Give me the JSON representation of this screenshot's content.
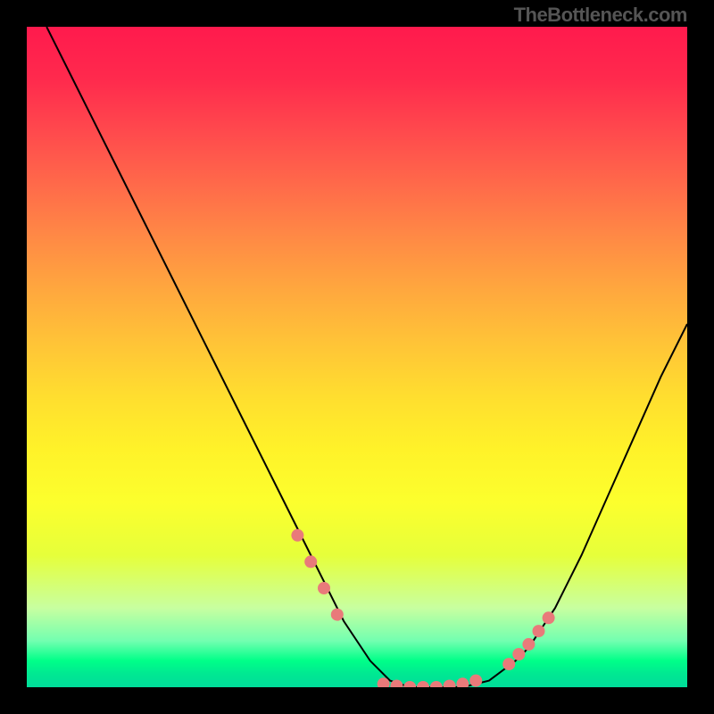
{
  "watermark": "TheBottleneck.com",
  "colors": {
    "marker": "#e97a7a",
    "curve": "#000000"
  },
  "chart_data": {
    "type": "line",
    "title": "",
    "xlabel": "",
    "ylabel": "",
    "xlim": [
      0,
      100
    ],
    "ylim": [
      0,
      100
    ],
    "grid": false,
    "series": [
      {
        "name": "bottleneck-curve",
        "x": [
          3,
          8,
          13,
          18,
          23,
          28,
          33,
          38,
          43,
          48,
          52,
          55,
          58,
          62,
          66,
          70,
          74,
          76,
          80,
          84,
          88,
          92,
          96,
          100
        ],
        "y": [
          100,
          90,
          80,
          70,
          60,
          50,
          40,
          30,
          20,
          10,
          4,
          1,
          0,
          0,
          0,
          1,
          4,
          6,
          12,
          20,
          29,
          38,
          47,
          55
        ]
      }
    ],
    "markers": {
      "name": "highlight-dots",
      "x": [
        41,
        43,
        45,
        47,
        54,
        56,
        58,
        60,
        62,
        64,
        66,
        68,
        73,
        74.5,
        76,
        77.5,
        79
      ],
      "y": [
        23,
        19,
        15,
        11,
        0.5,
        0.2,
        0,
        0,
        0,
        0.2,
        0.5,
        1,
        3.5,
        5,
        6.5,
        8.5,
        10.5
      ]
    }
  }
}
